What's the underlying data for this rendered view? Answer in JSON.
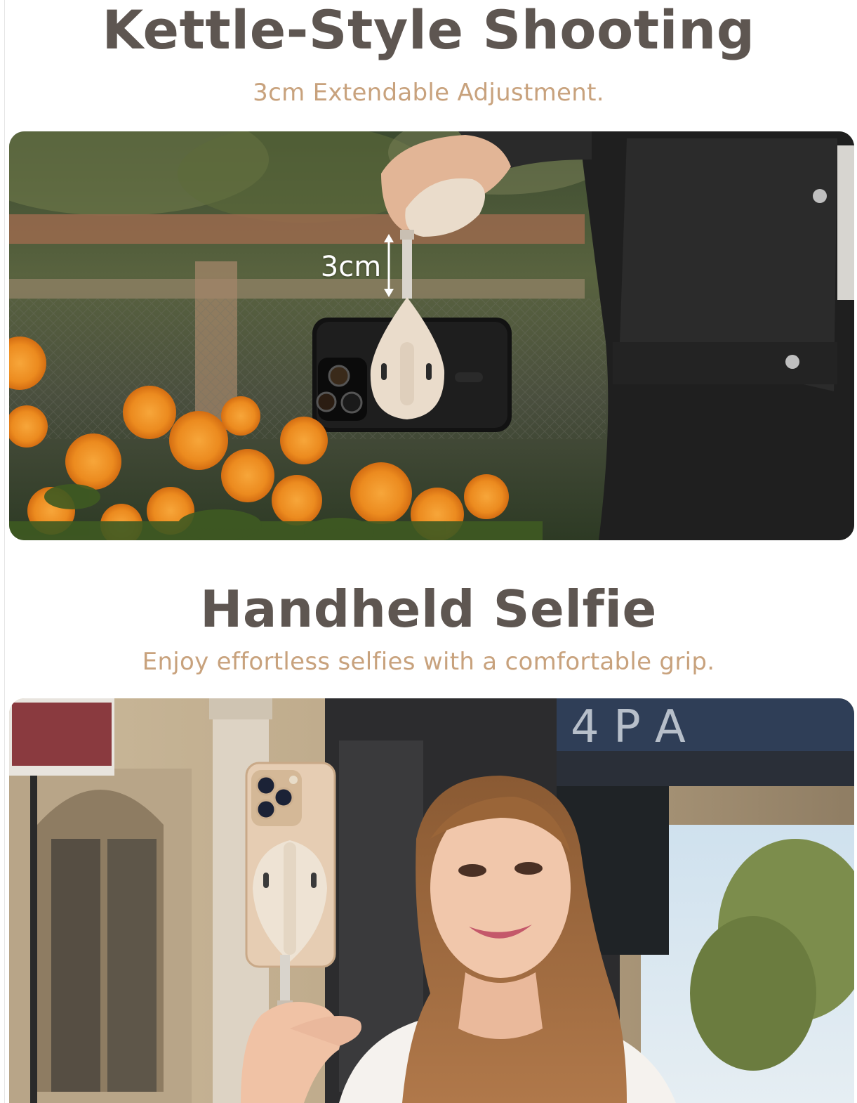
{
  "section1": {
    "title": "Kettle-Style Shooting",
    "subtitle": "3cm Extendable Adjustment.",
    "measure_label": "3cm"
  },
  "section2": {
    "title": "Handheld Selfie",
    "subtitle": "Enjoy effortless selfies with a comfortable grip.",
    "sign_text": "4 P A"
  },
  "colors": {
    "title": "#5e5651",
    "subtitle": "#c8a27d",
    "accessory": "#eadccb"
  }
}
